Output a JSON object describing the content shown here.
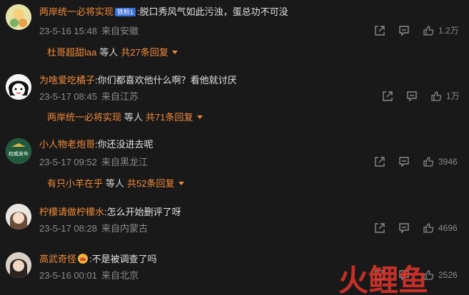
{
  "comments": [
    {
      "username": "两岸统一必将实现",
      "badge": "铁粉1",
      "has_crown": false,
      "text": ":脱口秀风气如此污浊，蛋总功不可没",
      "time": "23-5-16 15:48",
      "location": "来自安徽",
      "likes": "1.2万",
      "reply": {
        "user": "杜哥超甜laa",
        "mid": "等人",
        "count": "共27条回复"
      }
    },
    {
      "username": "为啥爱吃橘子",
      "badge": "",
      "has_crown": false,
      "text": ":你们都喜欢他什么啊？看他就讨厌",
      "time": "23-5-17 08:45",
      "location": "来自江苏",
      "likes": "1万",
      "reply": {
        "user": "两岸统一必将实现",
        "mid": "等人",
        "count": "共71条回复"
      }
    },
    {
      "username": "小人物老炮哥",
      "badge": "",
      "has_crown": false,
      "text": ":你还没进去呢",
      "time": "23-5-17 09:52",
      "location": "来自黑龙江",
      "likes": "3946",
      "reply": {
        "user": "有只小羊在乎",
        "mid": "等人",
        "count": "共52条回复"
      }
    },
    {
      "username": "柠檬请做柠檬水",
      "badge": "",
      "has_crown": false,
      "text": ":怎么开始删评了呀",
      "time": "23-5-17 08:28",
      "location": "来自内蒙古",
      "likes": "4696",
      "reply": null
    },
    {
      "username": "高武奇怪",
      "badge": "",
      "has_crown": true,
      "text": ":不是被调查了吗",
      "time": "23-5-16 00:01",
      "location": "来自北京",
      "likes": "2526",
      "reply": null
    }
  ],
  "avatar3_text": "权威发布",
  "watermark_text": "火鲤鱼",
  "colors": {
    "username": "#f08a3a",
    "background": "#191919",
    "meta": "#8a8a8a"
  },
  "icons": [
    "share-icon",
    "comment-icon",
    "like-icon",
    "crown-icon",
    "reply-expand-arrow"
  ]
}
